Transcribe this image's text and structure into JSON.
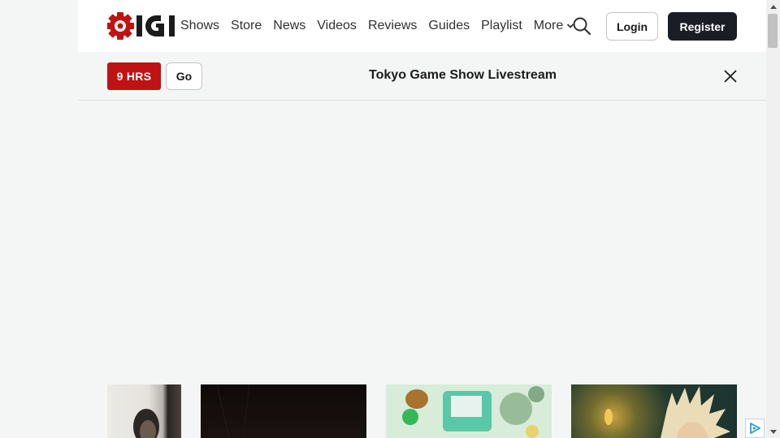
{
  "header": {
    "logo_text": "IGN",
    "nav_items": [
      "Shows",
      "Store",
      "News",
      "Videos",
      "Reviews",
      "Guides",
      "Playlist"
    ],
    "more_label": "More",
    "login_label": "Login",
    "register_label": "Register"
  },
  "banner": {
    "countdown": "9 HRS",
    "go_label": "Go",
    "title": "Tokyo Game Show Livestream"
  },
  "thumbnails": [
    {
      "name": "thumbnail-1"
    },
    {
      "name": "thumbnail-2"
    },
    {
      "name": "thumbnail-3"
    },
    {
      "name": "thumbnail-4"
    }
  ],
  "icons": {
    "search": "search-icon",
    "close": "close-icon",
    "chevron": "chevron-down-icon",
    "adchoices": "adchoices-icon"
  },
  "colors": {
    "brand_red": "#bf1313",
    "register_bg": "#1b1d25",
    "page_bg": "#f4f6f5"
  }
}
